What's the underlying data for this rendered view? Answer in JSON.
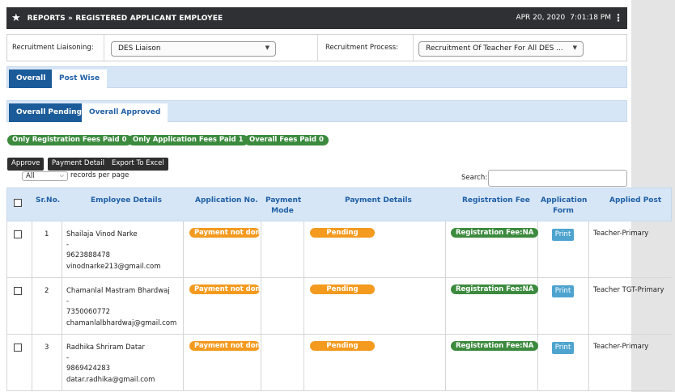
{
  "header": {
    "title": "REPORTS » REGISTERED APPLICANT EMPLOYEE",
    "date": "APR 20, 2020",
    "time": "7:01:18 PM"
  },
  "filters": {
    "liaisoning_label": "Recruitment Liaisoning:",
    "liaisoning_value": "DES Liaison",
    "process_label": "Recruitment Process:",
    "process_value": "Recruitment Of Teacher For All DES ..."
  },
  "tabs_main": [
    "Overall",
    "Post Wise"
  ],
  "tabs_sub": [
    "Overall Pending",
    "Overall Approved"
  ],
  "badges": [
    "Only Registration Fees Paid  0",
    "Only Application Fees Paid  1",
    "Overall Fees Paid  0"
  ],
  "actions": {
    "approve": "Approve",
    "payment_detail": "Payment Detail",
    "export": "Export To Excel"
  },
  "table_controls": {
    "rpp_value": "All",
    "rpp_label": "records per page",
    "search_label": "Search:"
  },
  "columns": {
    "sr": "Sr.No.",
    "emp": "Employee Details",
    "app_no": "Application No.",
    "pay_mode_1": "Payment",
    "pay_mode_2": "Mode",
    "pay_details": "Payment Details",
    "reg_fee": "Registration Fee",
    "app_form_1": "Application",
    "app_form_2": "Form",
    "post": "Applied Post"
  },
  "rows": [
    {
      "sr": "1",
      "name": "Shailaja Vinod Narke",
      "dash": "-",
      "phone": "9623888478",
      "email": "vinodnarke213@gmail.com",
      "app_status": "Payment not done",
      "pay_status": "Pending",
      "reg_fee": "Registration Fee:NA",
      "print": "Print",
      "post": "Teacher-Primary"
    },
    {
      "sr": "2",
      "name": "Chamanlal Mastram Bhardwaj",
      "dash": "-",
      "phone": "7350060772",
      "email": "chamanlalbhardwaj@gmail.com",
      "app_status": "Payment not done",
      "pay_status": "Pending",
      "reg_fee": "Registration Fee:NA",
      "print": "Print",
      "post": "Teacher TGT-Primary"
    },
    {
      "sr": "3",
      "name": "Radhika Shriram Datar",
      "dash": "-",
      "phone": "9869424283",
      "email": "datar.radhika@gmail.com",
      "app_status": "Payment not done",
      "pay_status": "Pending",
      "reg_fee": "Registration Fee:NA",
      "print": "Print",
      "post": "Teacher-Primary"
    }
  ]
}
